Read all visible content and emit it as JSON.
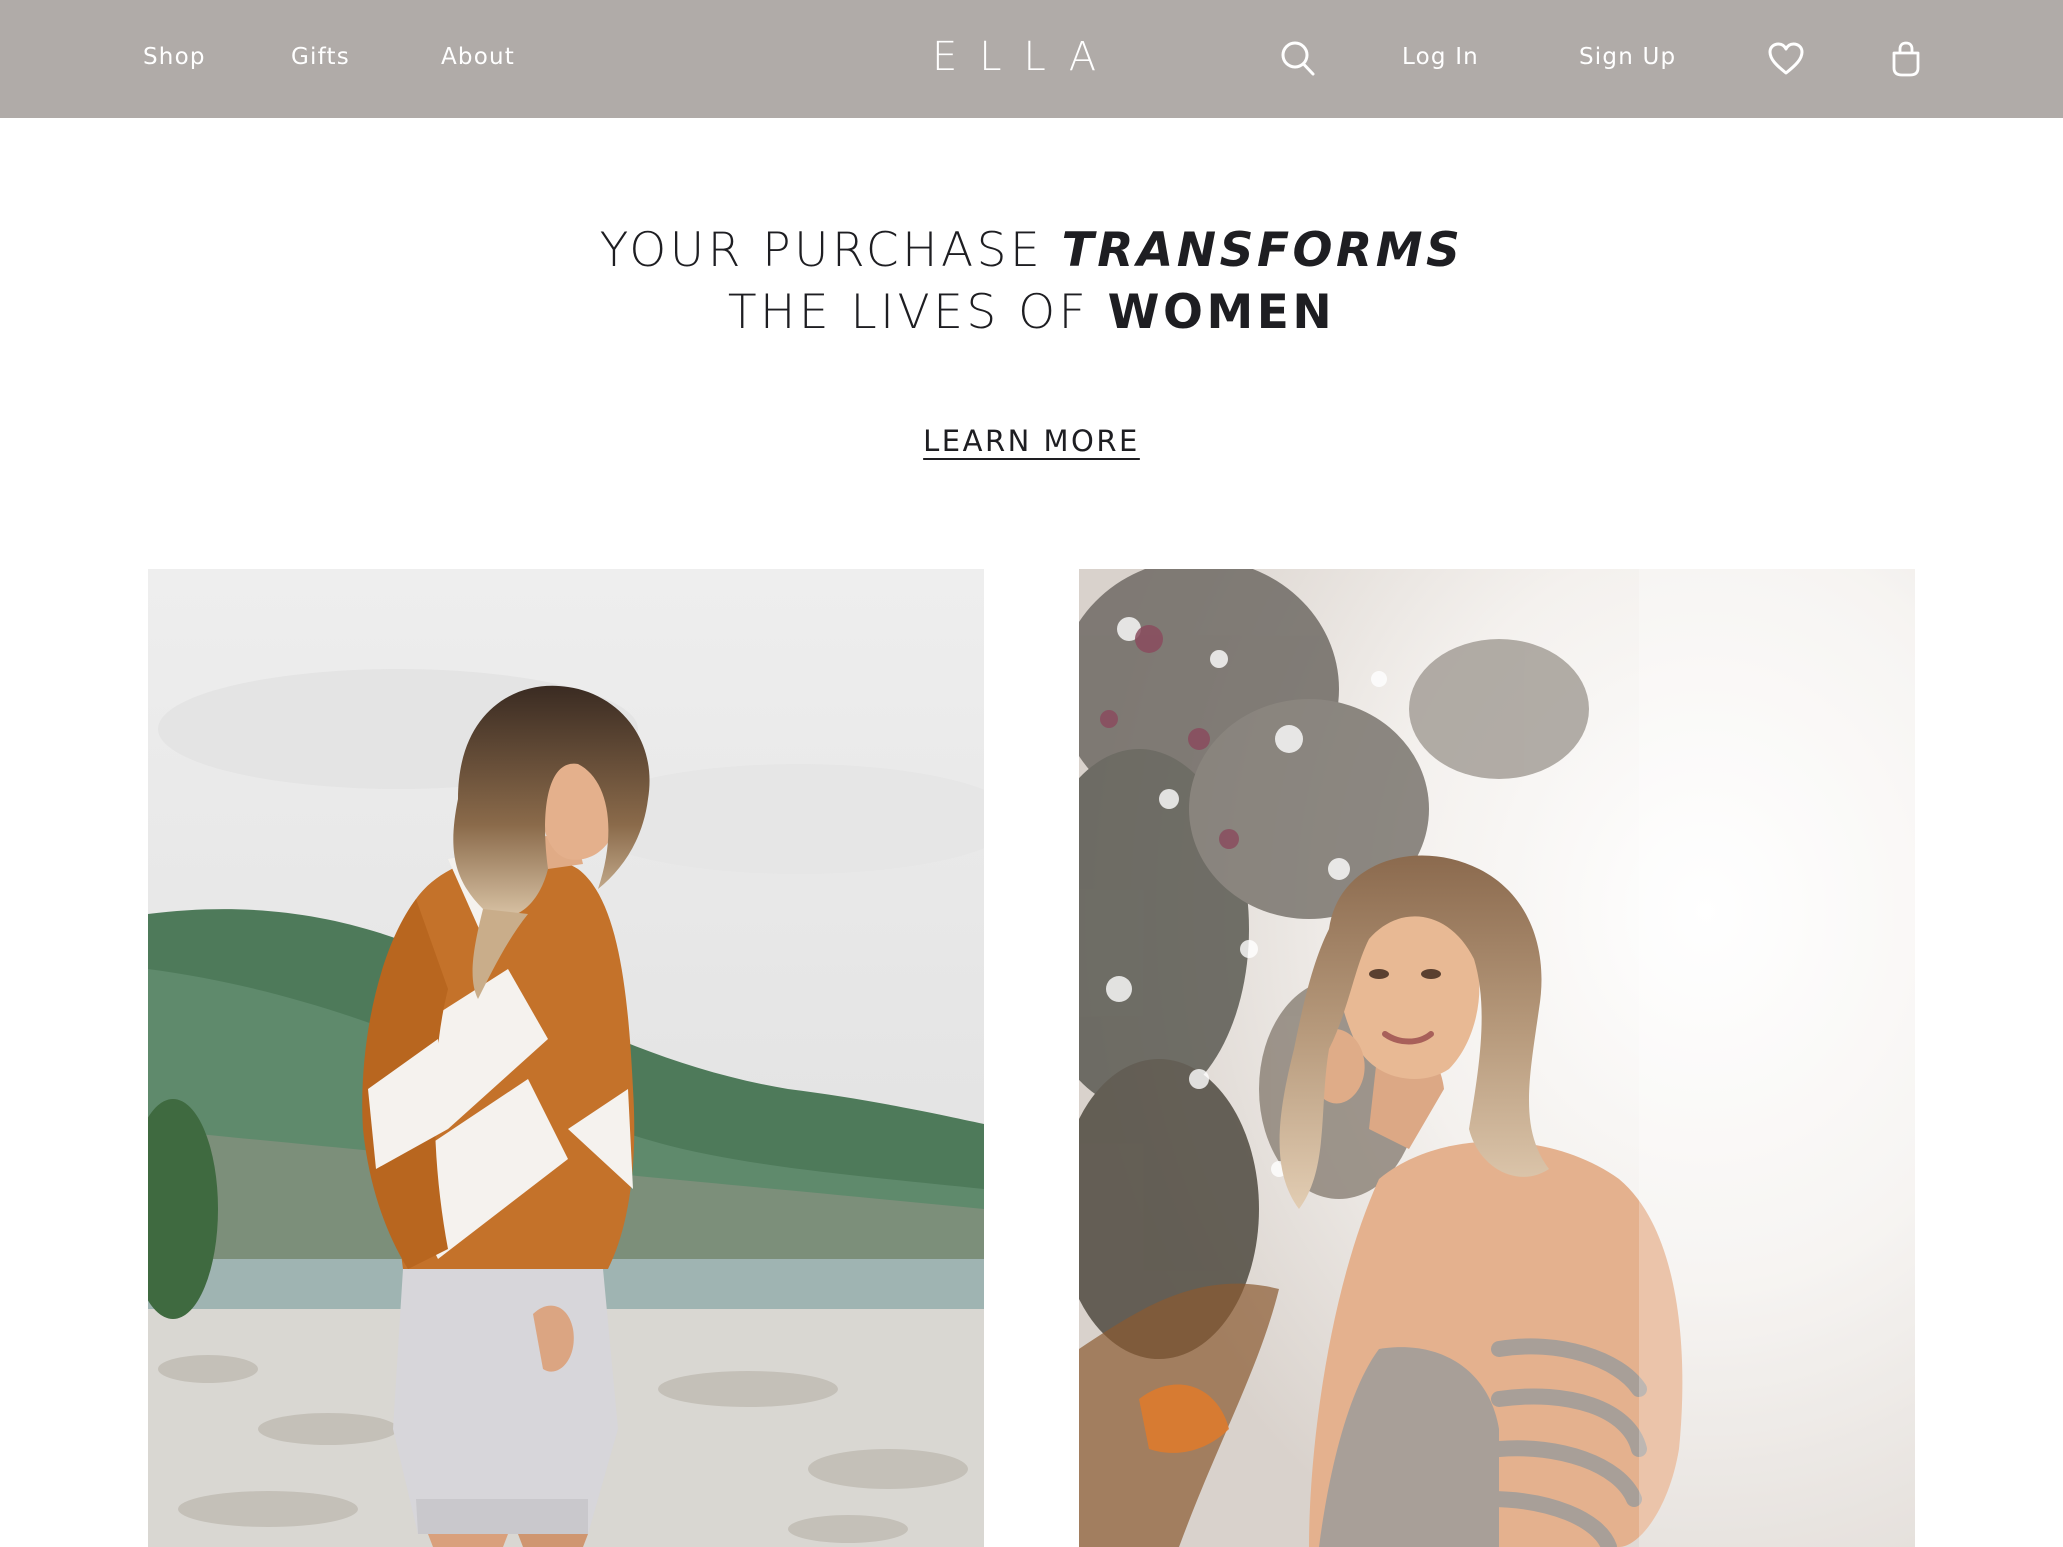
{
  "header": {
    "nav": [
      "Shop",
      "Gifts",
      "About"
    ],
    "logo": "ELLA",
    "login_label": "Log In",
    "signup_label": "Sign Up",
    "icons": [
      "search-icon",
      "heart-icon",
      "bag-icon"
    ],
    "background_color": "#b0aba8"
  },
  "hero": {
    "line1_prefix": "YOUR PURCHASE",
    "line1_emphasis": "TRANSFORMS",
    "line2_prefix": "THE LIVES OF",
    "line2_emphasis": "WOMEN",
    "cta_label": "LEARN MORE"
  },
  "gallery": {
    "items": [
      "woman-in-striped-sweater-photo",
      "woman-in-sunlit-field-photo"
    ]
  }
}
